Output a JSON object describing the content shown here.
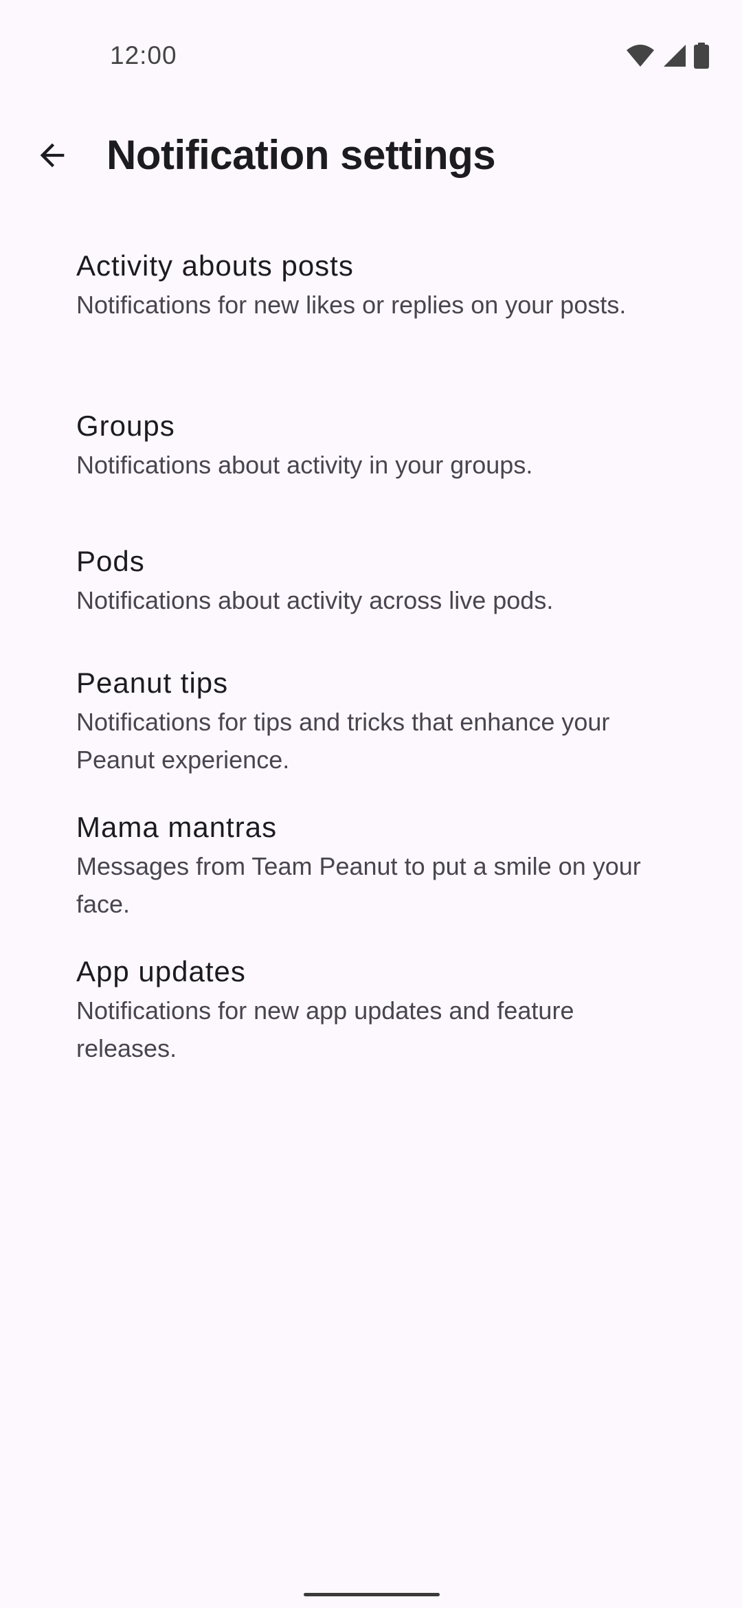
{
  "status_bar": {
    "time": "12:00",
    "icons": [
      "wifi-icon",
      "cellular-signal-icon",
      "battery-icon"
    ]
  },
  "app_bar": {
    "back_icon": "arrow-back-icon",
    "title": "Notification settings"
  },
  "settings": [
    {
      "title": "Activity abouts posts",
      "description": "Notifications for new likes or replies on your posts."
    },
    {
      "title": "Groups",
      "description": "Notifications about activity in your groups."
    },
    {
      "title": "Pods",
      "description": "Notifications about activity across live pods."
    },
    {
      "title": "Peanut tips",
      "description": "Notifications for tips and tricks that enhance your Peanut experience."
    },
    {
      "title": "Mama mantras",
      "description": "Messages from Team Peanut to put a smile on your face."
    },
    {
      "title": "App updates",
      "description": "Notifications for new app updates and feature releases."
    }
  ],
  "colors": {
    "background": "#fdf8fd",
    "title_text": "#1c1b1f",
    "secondary_text": "#49454f"
  }
}
